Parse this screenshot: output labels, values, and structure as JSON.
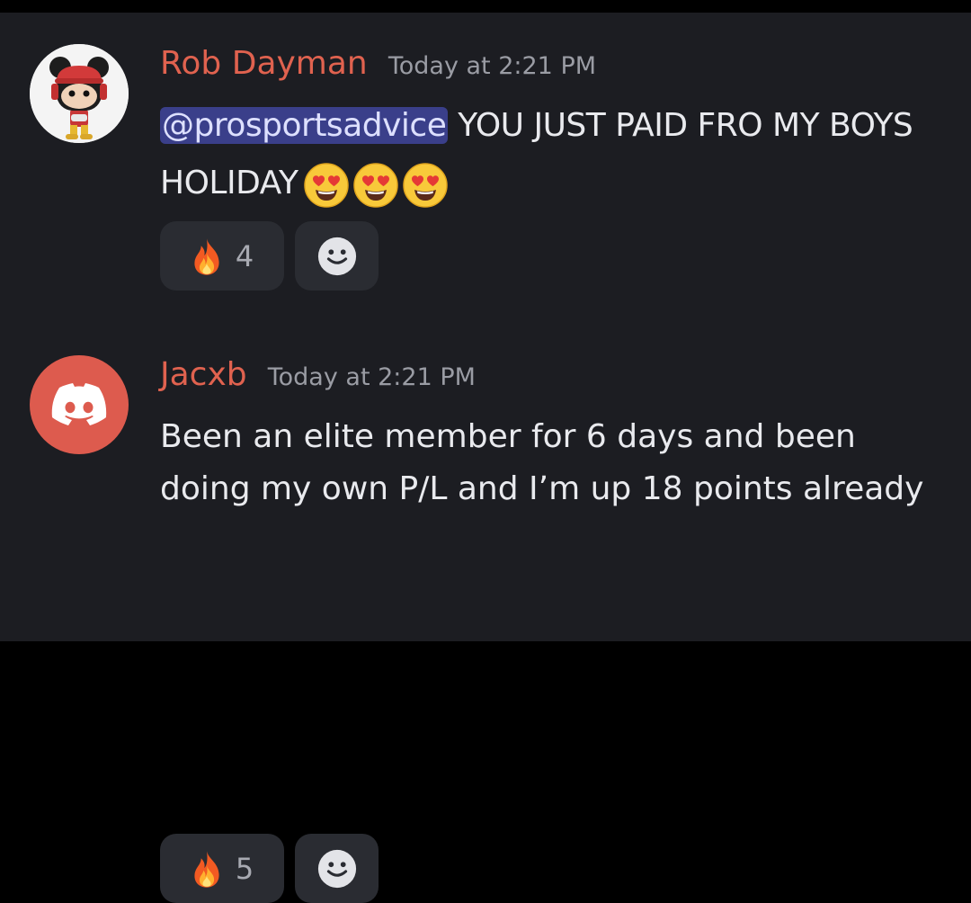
{
  "messages": [
    {
      "username": "Rob Dayman",
      "timestamp": "Today at 2:21 PM",
      "mention": "@prosportsadvice",
      "text": " YOU JUST PAID FRO MY BOYS HOLIDAY",
      "avatar_icon": "mickey-funko-avatar",
      "inline_emojis": [
        "heart-eyes-emoji",
        "heart-eyes-emoji",
        "heart-eyes-emoji"
      ],
      "reaction": {
        "icon": "fire-emoji",
        "count": "4"
      },
      "add_reaction_icon": "smiley-add-reaction-icon"
    },
    {
      "username": "Jacxb",
      "timestamp": "Today at 2:21 PM",
      "text": "Been an elite member for 6 days and been doing my own P/L and I’m up 18 points already",
      "avatar_icon": "discord-logo-avatar",
      "reaction": {
        "icon": "fire-emoji",
        "count": "5"
      },
      "add_reaction_icon": "smiley-add-reaction-icon"
    }
  ],
  "colors": {
    "background": "#1c1d22",
    "username": "#e0624f",
    "timestamp": "#9a9ca4",
    "text": "#e9eaee",
    "mention_bg": "#3a3f8a",
    "reaction_bg": "#2a2c32",
    "discord_avatar": "#dd5b4e"
  }
}
